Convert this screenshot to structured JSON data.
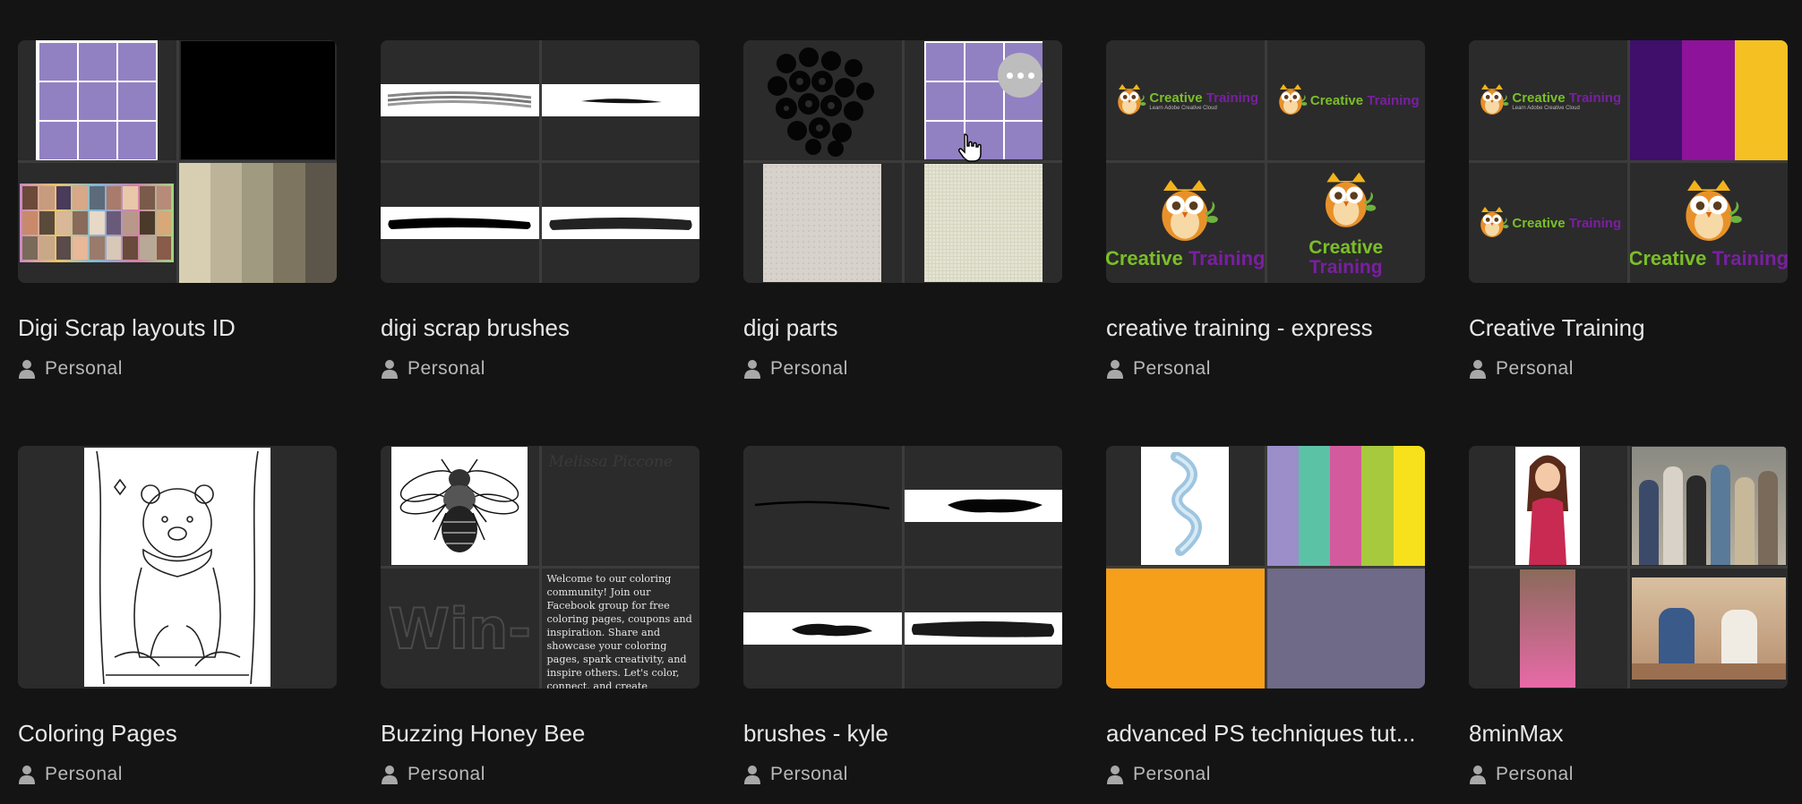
{
  "cards": [
    {
      "title": "Digi Scrap layouts ID",
      "owner": "Personal"
    },
    {
      "title": "digi scrap brushes",
      "owner": "Personal"
    },
    {
      "title": "digi parts",
      "owner": "Personal"
    },
    {
      "title": "creative training - express",
      "owner": "Personal"
    },
    {
      "title": "Creative Training",
      "owner": "Personal"
    },
    {
      "title": "Coloring Pages",
      "owner": "Personal"
    },
    {
      "title": "Buzzing Honey Bee",
      "owner": "Personal"
    },
    {
      "title": "brushes - kyle",
      "owner": "Personal"
    },
    {
      "title": "advanced PS techniques tut...",
      "owner": "Personal"
    },
    {
      "title": "8minMax",
      "owner": "Personal"
    }
  ],
  "logo": {
    "word1": "Creative",
    "word2": "Training",
    "tagline": "Learn Adobe Creative Cloud"
  },
  "bee_card": {
    "signature": "Melissa Piccone",
    "win_text": "Win-",
    "blurb": "Welcome to our coloring community! Join our Facebook group for free coloring pages, coupons and inspiration. Share and showcase your coloring pages, spark creativity, and inspire others. Let's color, connect, and create together!"
  },
  "colors": {
    "page_bg": "#141414",
    "cell_bg": "#2b2b2b",
    "purple": "#9281c2",
    "logo_green": "#7bbf27",
    "logo_purple": "#7a1fa2"
  },
  "icons": {
    "owner": "person-icon",
    "more": "more-options-icon",
    "cursor": "hand-pointer-icon"
  }
}
